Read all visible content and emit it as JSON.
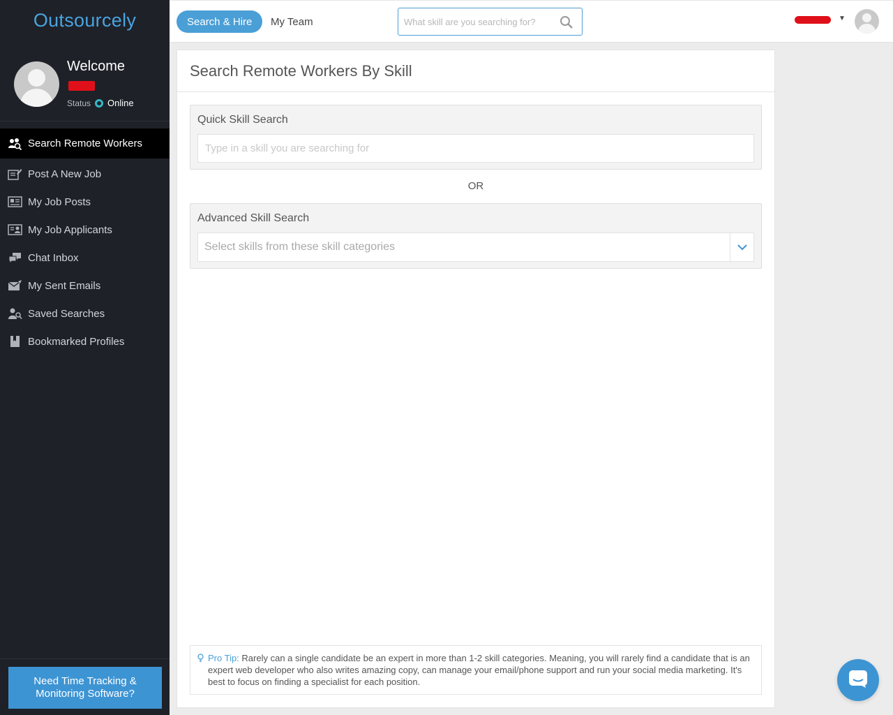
{
  "brand": "Outsourcely",
  "profile": {
    "welcome": "Welcome",
    "status_label": "Status",
    "status_value": "Online"
  },
  "sidebar": {
    "items": [
      {
        "label": "Search Remote Workers",
        "icon": "search-workers-icon",
        "active": true
      },
      {
        "label": "Post A New Job",
        "icon": "post-job-icon"
      },
      {
        "label": "My Job Posts",
        "icon": "job-posts-icon"
      },
      {
        "label": "My Job Applicants",
        "icon": "applicants-icon"
      },
      {
        "label": "Chat Inbox",
        "icon": "chat-icon"
      },
      {
        "label": "My Sent Emails",
        "icon": "email-icon"
      },
      {
        "label": "Saved Searches",
        "icon": "saved-search-icon"
      },
      {
        "label": "Bookmarked Profiles",
        "icon": "bookmark-icon"
      }
    ],
    "bottom_button": "Need Time Tracking & Monitoring Software?"
  },
  "topbar": {
    "tabs": [
      {
        "label": "Search & Hire",
        "active": true
      },
      {
        "label": "My Team"
      }
    ],
    "search_placeholder": "What skill are you searching for?"
  },
  "main": {
    "title": "Search Remote Workers By Skill",
    "quick": {
      "title": "Quick Skill Search",
      "placeholder": "Type in a skill you are searching for"
    },
    "or_text": "OR",
    "advanced": {
      "title": "Advanced Skill Search",
      "placeholder": "Select skills from these skill categories"
    },
    "tip": {
      "label": "Pro Tip:",
      "text": "Rarely can a single candidate be an expert in more than 1-2 skill categories. Meaning, you will rarely find a candidate that is an expert web developer who also writes amazing copy, can manage your email/phone support and run your social media marketing. It's best to focus on finding a specialist for each position."
    }
  },
  "colors": {
    "accent": "#4a9fd6",
    "sidebar_bg": "#1e2128",
    "status_online": "#35b7c4",
    "redaction": "#e0101a"
  }
}
